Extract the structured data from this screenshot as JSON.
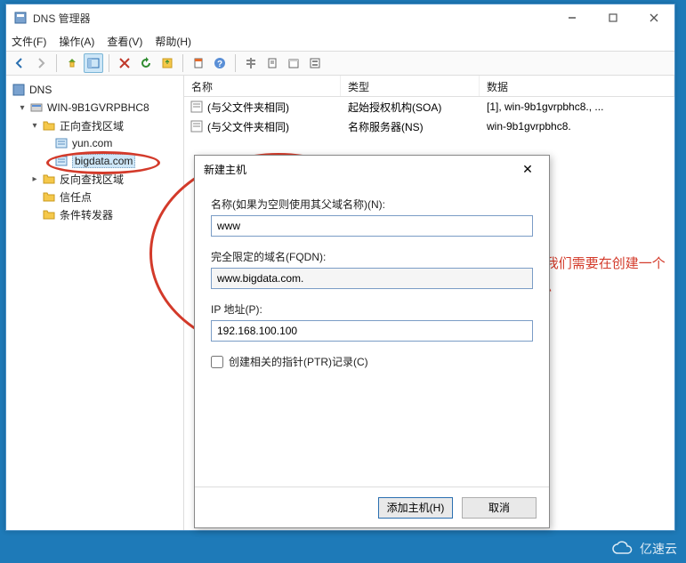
{
  "window": {
    "title": "DNS 管理器",
    "menu": {
      "file": "文件(F)",
      "action": "操作(A)",
      "view": "查看(V)",
      "help": "帮助(H)"
    }
  },
  "tree": {
    "root": "DNS",
    "server": "WIN-9B1GVRPBHC8",
    "fwd_zones": "正向查找区域",
    "zone_yun": "yun.com",
    "zone_bigdata": "bigdata.com",
    "rev_zones": "反向查找区域",
    "trust_points": "信任点",
    "cond_fwd": "条件转发器"
  },
  "list": {
    "headers": {
      "name": "名称",
      "type": "类型",
      "data": "数据"
    },
    "rows": [
      {
        "name": "(与父文件夹相同)",
        "type": "起始授权机构(SOA)",
        "data": "[1], win-9b1gvrpbhc8., ..."
      },
      {
        "name": "(与父文件夹相同)",
        "type": "名称服务器(NS)",
        "data": "win-9b1gvrpbhc8."
      }
    ]
  },
  "dialog": {
    "title": "新建主机",
    "name_label": "名称(如果为空则使用其父域名称)(N):",
    "name_value": "www",
    "fqdn_label": "完全限定的域名(FQDN):",
    "fqdn_value": "www.bigdata.com.",
    "ip_label": "IP 地址(P):",
    "ip_value": "192.168.100.100",
    "ptr_label": "创建相关的指针(PTR)记录(C)",
    "add_btn": "添加主机(H)",
    "cancel_btn": "取消"
  },
  "annotation": "同上述yun.com创建相同，我们需要在创建一个bigdata，新建主机输入信息",
  "watermark": "亿速云"
}
